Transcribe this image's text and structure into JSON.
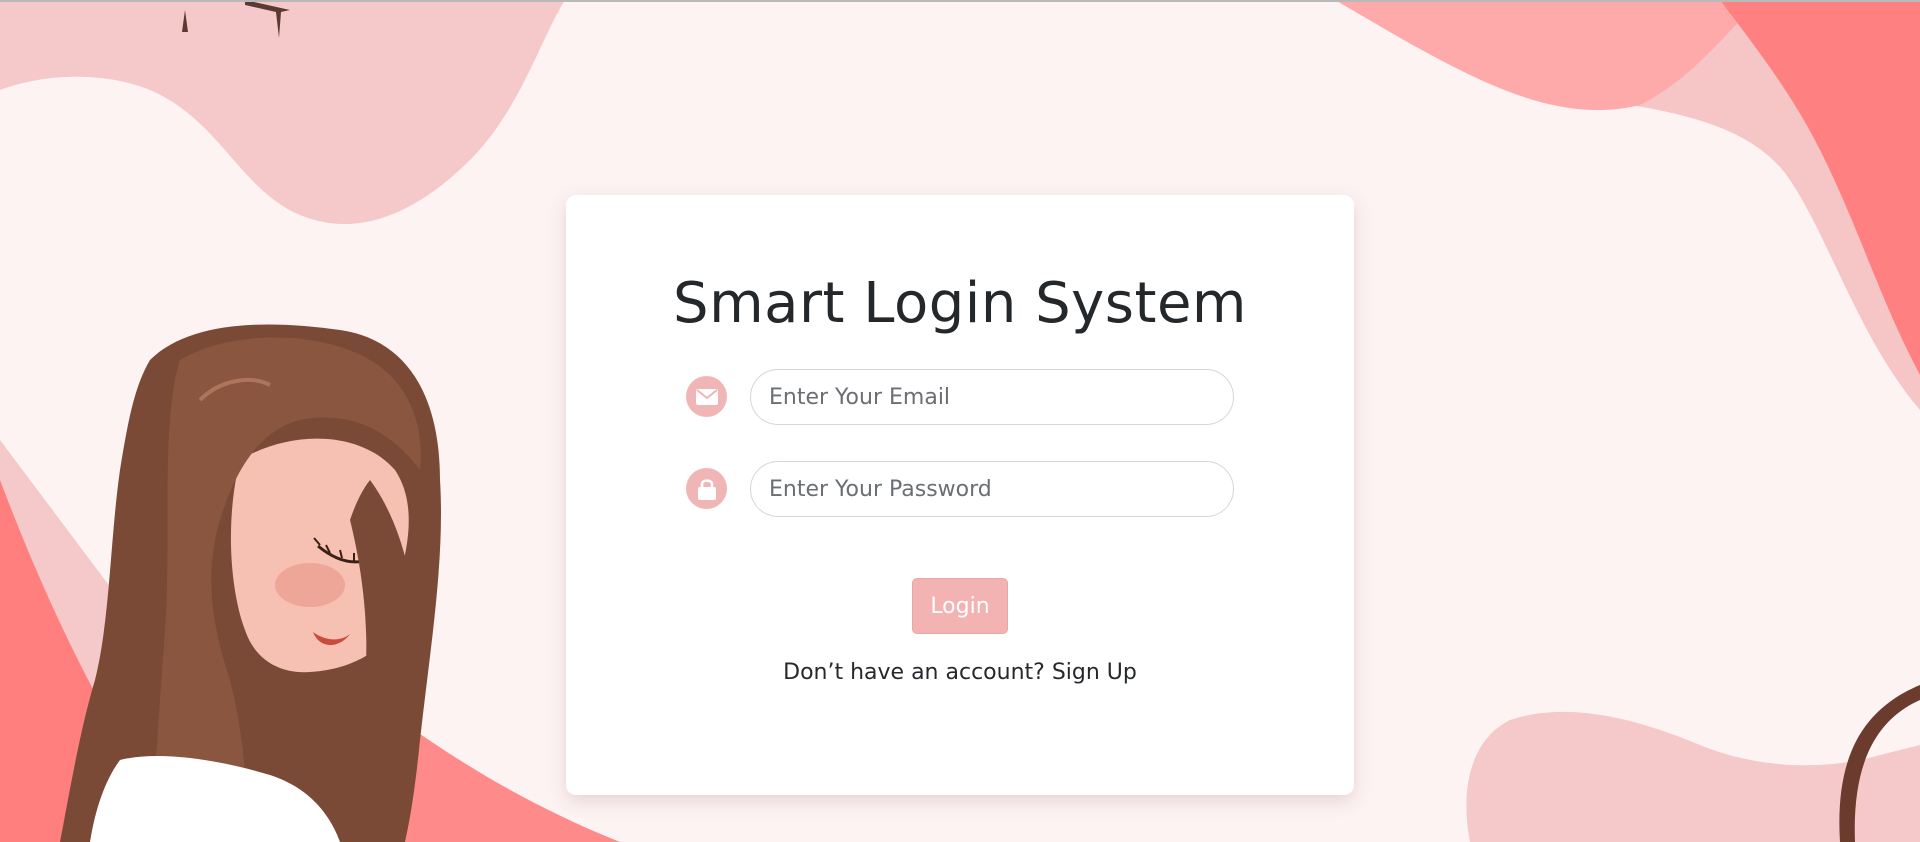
{
  "login_card": {
    "title": "Smart Login System",
    "email_field": {
      "placeholder": "Enter Your Email",
      "value": "",
      "icon": "envelope-icon"
    },
    "password_field": {
      "placeholder": "Enter Your Password",
      "value": "",
      "icon": "lock-icon"
    },
    "login_button_label": "Login",
    "signup_prompt": "Don’t have an account?",
    "signup_link_label": "Sign Up"
  },
  "theme": {
    "background": "#fdf3f3",
    "accent_pink": "#f0b6b6",
    "coral": "#ff7f7f",
    "blob_pink": "#f5c9c9",
    "title_color": "#25282b"
  },
  "illustration": {
    "subject": "girl-with-long-brown-hair-illustration"
  }
}
